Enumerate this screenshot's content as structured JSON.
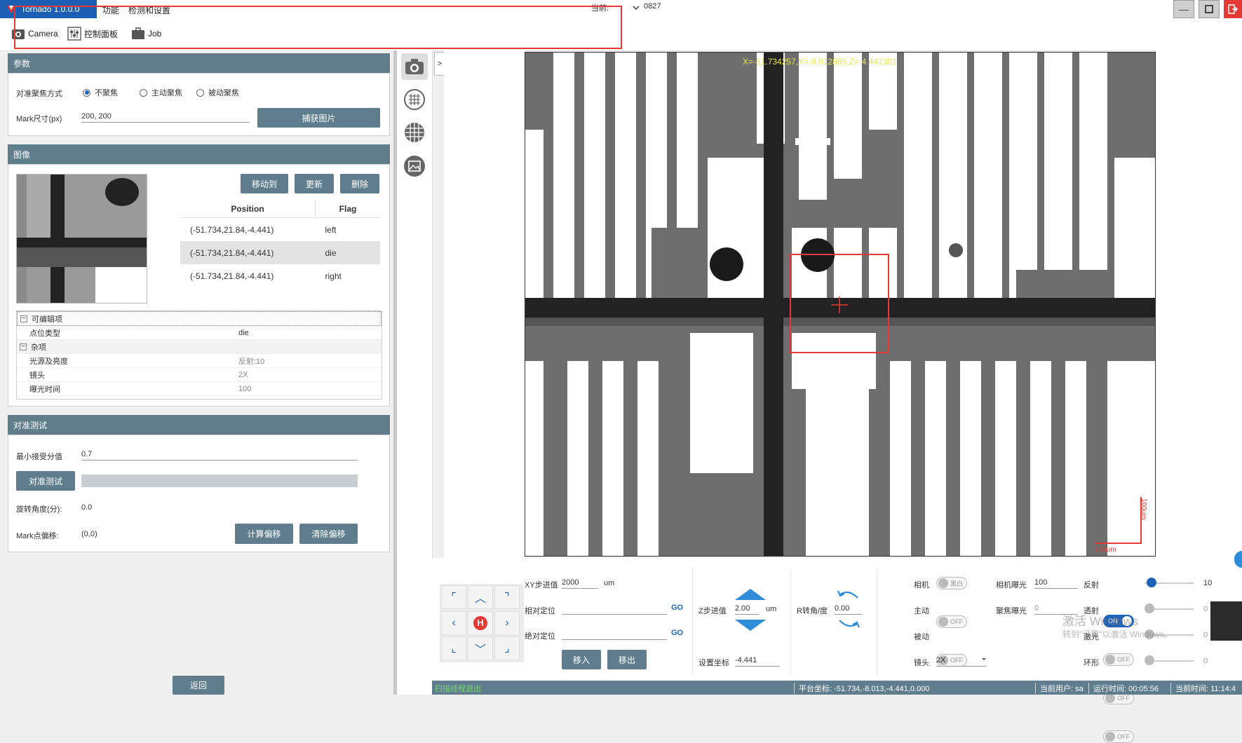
{
  "window": {
    "title": "Tornado 1.0.0.0",
    "menu": [
      "功能",
      "检测和设置"
    ],
    "current_label": "当前:",
    "current_value": "0827"
  },
  "toolbar": {
    "camera": "Camera",
    "control_panel": "控制面板",
    "job": "Job"
  },
  "params": {
    "header": "参数",
    "focus_label": "对准聚焦方式",
    "focus_options": [
      "不聚焦",
      "主动聚焦",
      "被动聚焦"
    ],
    "focus_selected": "不聚焦",
    "mark_size_label": "Mark尺寸(px)",
    "mark_size_value": "200, 200",
    "capture_button": "捕获图片"
  },
  "image": {
    "header": "图像",
    "buttons": {
      "move_to": "移动到",
      "update": "更新",
      "delete": "删除"
    },
    "table": {
      "columns": [
        "Position",
        "Flag"
      ],
      "rows": [
        {
          "position": "(-51.734,21.84,-4.441)",
          "flag": "left"
        },
        {
          "position": "(-51.734,21.84,-4.441)",
          "flag": "die"
        },
        {
          "position": "(-51.734,21.84,-4.441)",
          "flag": "right"
        }
      ]
    },
    "props": {
      "group_editable": "可编辑项",
      "point_type_label": "点位类型",
      "point_type_value": "die",
      "group_misc": "杂项",
      "light_label": "光源及亮度",
      "light_value": "反射:10",
      "lens_label": "镜头",
      "lens_value": "2X",
      "exposure_label": "曝光时间",
      "exposure_value": "100"
    }
  },
  "align_test": {
    "header": "对准测试",
    "min_score_label": "最小接受分值",
    "min_score_value": "0.7",
    "test_button": "对准测试",
    "rotation_label": "旋转角度(分):",
    "rotation_value": "0.0",
    "mark_offset_label": "Mark点偏移:",
    "mark_offset_value": "(0,0)",
    "calc_offset_button": "计算偏移",
    "clear_offset_button": "清除偏移",
    "back_button": "返回"
  },
  "viewer": {
    "coord_text": "X=-51.734257,Y=-8.012885,Z=-4.441301",
    "scale_v": "100um",
    "scale_h": "100um",
    "collapse_arrow": ">"
  },
  "controls": {
    "xy_step_label": "XY步进值",
    "xy_step_value": "2000",
    "xy_unit": "um",
    "rel_pos_label": "相对定位",
    "abs_pos_label": "绝对定位",
    "go": "GO",
    "move_in": "移入",
    "move_out": "移出",
    "z_step_label": "Z步进值",
    "z_step_value": "2.00",
    "z_unit": "um",
    "set_coord_label": "设置坐标",
    "set_coord_value": "-4.441",
    "r_rot_label": "R转角/度",
    "r_rot_value": "0.00",
    "home": "H",
    "camera_label": "相机",
    "camera_toggle": "黑白",
    "active_label": "主动",
    "active_toggle": "OFF",
    "passive_label": "被动",
    "passive_toggle": "OFF",
    "lens_label": "镜头",
    "lens_value": "2X",
    "cam_exposure_label": "相机曝光",
    "cam_exposure_value": "100",
    "focus_exposure_label": "聚焦曝光",
    "focus_exposure_value": "0",
    "reflect_label": "反射",
    "reflect_toggle": "ON",
    "reflect_value": "10",
    "reflect_level": 0.05,
    "transmit_label": "透射",
    "transmit_toggle": "OFF",
    "transmit_value": "0",
    "laser_label": "激光",
    "laser_toggle": "OFF",
    "laser_value": "0",
    "ring_label": "环形",
    "ring_toggle": "OFF",
    "ring_value": "0",
    "watermark_line1": "激活 Windows",
    "watermark_line2": "转到\"设置\"以激活 Windows。"
  },
  "status": {
    "left": "扫描线程退出",
    "platform": "平台坐标: -51.734,-8.013,-4.441,0.000",
    "user": "当前用户: sa",
    "runtime": "运行时间: 00:05:56",
    "time": "当前时间: 11:14:4"
  },
  "colors": {
    "accent": "#1e63b7",
    "header": "#607d8b",
    "button": "#5f7d8c",
    "marker": "#e53935"
  }
}
